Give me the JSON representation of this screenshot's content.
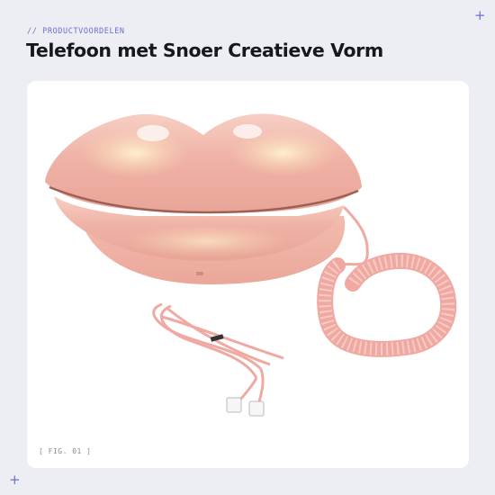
{
  "header": {
    "eyebrow": "// PRODUCTVOORDELEN",
    "title": "Telefoon met Snoer Creatieve Vorm"
  },
  "figure": {
    "caption": "[ FIG. 01 ]",
    "subject": "lips-phone-image"
  },
  "decorations": {
    "corner_marker": "+"
  },
  "colors": {
    "page_background": "#eceef3",
    "accent": "#6a6fd0",
    "title": "#17181c",
    "card": "#ffffff",
    "lips": "#f2b9ad",
    "cord": "#f0a9a2"
  }
}
